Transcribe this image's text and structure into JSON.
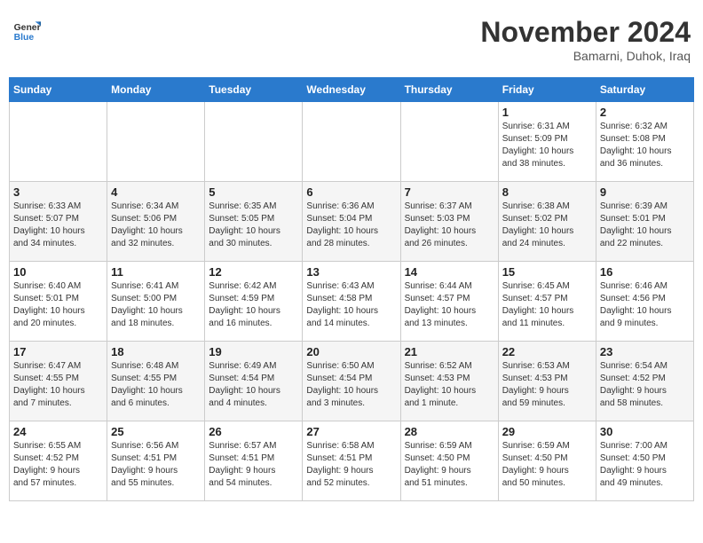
{
  "logo": {
    "general": "General",
    "blue": "Blue"
  },
  "header": {
    "month": "November 2024",
    "location": "Bamarni, Duhok, Iraq"
  },
  "weekdays": [
    "Sunday",
    "Monday",
    "Tuesday",
    "Wednesday",
    "Thursday",
    "Friday",
    "Saturday"
  ],
  "weeks": [
    [
      {
        "day": "",
        "info": ""
      },
      {
        "day": "",
        "info": ""
      },
      {
        "day": "",
        "info": ""
      },
      {
        "day": "",
        "info": ""
      },
      {
        "day": "",
        "info": ""
      },
      {
        "day": "1",
        "info": "Sunrise: 6:31 AM\nSunset: 5:09 PM\nDaylight: 10 hours\nand 38 minutes."
      },
      {
        "day": "2",
        "info": "Sunrise: 6:32 AM\nSunset: 5:08 PM\nDaylight: 10 hours\nand 36 minutes."
      }
    ],
    [
      {
        "day": "3",
        "info": "Sunrise: 6:33 AM\nSunset: 5:07 PM\nDaylight: 10 hours\nand 34 minutes."
      },
      {
        "day": "4",
        "info": "Sunrise: 6:34 AM\nSunset: 5:06 PM\nDaylight: 10 hours\nand 32 minutes."
      },
      {
        "day": "5",
        "info": "Sunrise: 6:35 AM\nSunset: 5:05 PM\nDaylight: 10 hours\nand 30 minutes."
      },
      {
        "day": "6",
        "info": "Sunrise: 6:36 AM\nSunset: 5:04 PM\nDaylight: 10 hours\nand 28 minutes."
      },
      {
        "day": "7",
        "info": "Sunrise: 6:37 AM\nSunset: 5:03 PM\nDaylight: 10 hours\nand 26 minutes."
      },
      {
        "day": "8",
        "info": "Sunrise: 6:38 AM\nSunset: 5:02 PM\nDaylight: 10 hours\nand 24 minutes."
      },
      {
        "day": "9",
        "info": "Sunrise: 6:39 AM\nSunset: 5:01 PM\nDaylight: 10 hours\nand 22 minutes."
      }
    ],
    [
      {
        "day": "10",
        "info": "Sunrise: 6:40 AM\nSunset: 5:01 PM\nDaylight: 10 hours\nand 20 minutes."
      },
      {
        "day": "11",
        "info": "Sunrise: 6:41 AM\nSunset: 5:00 PM\nDaylight: 10 hours\nand 18 minutes."
      },
      {
        "day": "12",
        "info": "Sunrise: 6:42 AM\nSunset: 4:59 PM\nDaylight: 10 hours\nand 16 minutes."
      },
      {
        "day": "13",
        "info": "Sunrise: 6:43 AM\nSunset: 4:58 PM\nDaylight: 10 hours\nand 14 minutes."
      },
      {
        "day": "14",
        "info": "Sunrise: 6:44 AM\nSunset: 4:57 PM\nDaylight: 10 hours\nand 13 minutes."
      },
      {
        "day": "15",
        "info": "Sunrise: 6:45 AM\nSunset: 4:57 PM\nDaylight: 10 hours\nand 11 minutes."
      },
      {
        "day": "16",
        "info": "Sunrise: 6:46 AM\nSunset: 4:56 PM\nDaylight: 10 hours\nand 9 minutes."
      }
    ],
    [
      {
        "day": "17",
        "info": "Sunrise: 6:47 AM\nSunset: 4:55 PM\nDaylight: 10 hours\nand 7 minutes."
      },
      {
        "day": "18",
        "info": "Sunrise: 6:48 AM\nSunset: 4:55 PM\nDaylight: 10 hours\nand 6 minutes."
      },
      {
        "day": "19",
        "info": "Sunrise: 6:49 AM\nSunset: 4:54 PM\nDaylight: 10 hours\nand 4 minutes."
      },
      {
        "day": "20",
        "info": "Sunrise: 6:50 AM\nSunset: 4:54 PM\nDaylight: 10 hours\nand 3 minutes."
      },
      {
        "day": "21",
        "info": "Sunrise: 6:52 AM\nSunset: 4:53 PM\nDaylight: 10 hours\nand 1 minute."
      },
      {
        "day": "22",
        "info": "Sunrise: 6:53 AM\nSunset: 4:53 PM\nDaylight: 9 hours\nand 59 minutes."
      },
      {
        "day": "23",
        "info": "Sunrise: 6:54 AM\nSunset: 4:52 PM\nDaylight: 9 hours\nand 58 minutes."
      }
    ],
    [
      {
        "day": "24",
        "info": "Sunrise: 6:55 AM\nSunset: 4:52 PM\nDaylight: 9 hours\nand 57 minutes."
      },
      {
        "day": "25",
        "info": "Sunrise: 6:56 AM\nSunset: 4:51 PM\nDaylight: 9 hours\nand 55 minutes."
      },
      {
        "day": "26",
        "info": "Sunrise: 6:57 AM\nSunset: 4:51 PM\nDaylight: 9 hours\nand 54 minutes."
      },
      {
        "day": "27",
        "info": "Sunrise: 6:58 AM\nSunset: 4:51 PM\nDaylight: 9 hours\nand 52 minutes."
      },
      {
        "day": "28",
        "info": "Sunrise: 6:59 AM\nSunset: 4:50 PM\nDaylight: 9 hours\nand 51 minutes."
      },
      {
        "day": "29",
        "info": "Sunrise: 6:59 AM\nSunset: 4:50 PM\nDaylight: 9 hours\nand 50 minutes."
      },
      {
        "day": "30",
        "info": "Sunrise: 7:00 AM\nSunset: 4:50 PM\nDaylight: 9 hours\nand 49 minutes."
      }
    ]
  ]
}
